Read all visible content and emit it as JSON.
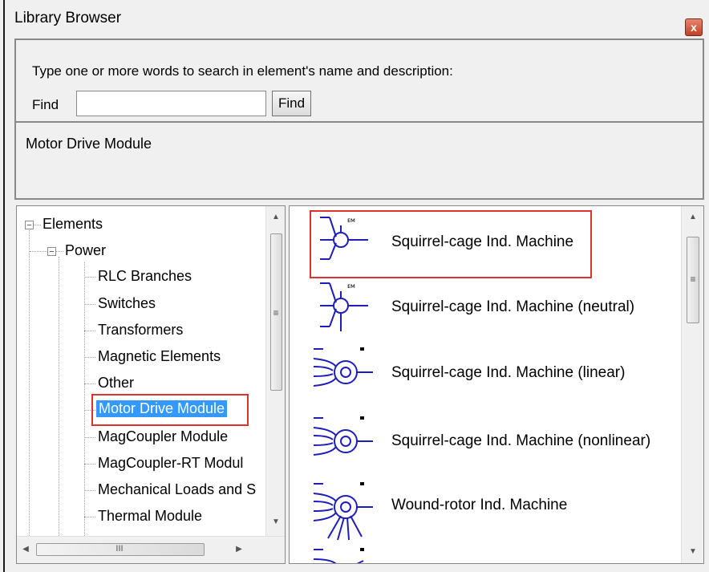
{
  "window": {
    "title": "Library Browser",
    "close_glyph": "x"
  },
  "search": {
    "instruction": "Type one or more words to search in element's name and  description:",
    "find_label": "Find",
    "find_value": "",
    "find_button": "Find"
  },
  "description": {
    "text": "Motor Drive Module"
  },
  "tree": {
    "root": {
      "label": "Elements",
      "expander": "−"
    },
    "power": {
      "label": "Power",
      "expander": "−"
    },
    "children": [
      {
        "label": "RLC Branches"
      },
      {
        "label": "Switches"
      },
      {
        "label": "Transformers"
      },
      {
        "label": "Magnetic Elements"
      },
      {
        "label": "Other"
      },
      {
        "label": "Motor Drive Module"
      },
      {
        "label": "MagCoupler Module"
      },
      {
        "label": "MagCoupler-RT Modul"
      },
      {
        "label": "Mechanical Loads and S"
      },
      {
        "label": "Thermal Module"
      }
    ],
    "selected_index": 5,
    "scroll_grip": "≡",
    "hscroll_grip": "III"
  },
  "elements": {
    "items": [
      {
        "label": "Squirrel-cage Ind. Machine",
        "icon": "squirrel-cage-machine-icon"
      },
      {
        "label": "Squirrel-cage Ind. Machine (neutral)",
        "icon": "squirrel-cage-neutral-icon"
      },
      {
        "label": "Squirrel-cage Ind. Machine (linear)",
        "icon": "squirrel-cage-linear-icon"
      },
      {
        "label": "Squirrel-cage Ind. Machine (nonlinear)",
        "icon": "squirrel-cage-nonlinear-icon"
      },
      {
        "label": "Wound-rotor Ind. Machine",
        "icon": "wound-rotor-machine-icon"
      }
    ],
    "scroll_grip": "≡"
  },
  "colors": {
    "highlight_box": "#e03030",
    "selection": "#3399ff",
    "symbol_stroke": "#1f1fb8"
  }
}
